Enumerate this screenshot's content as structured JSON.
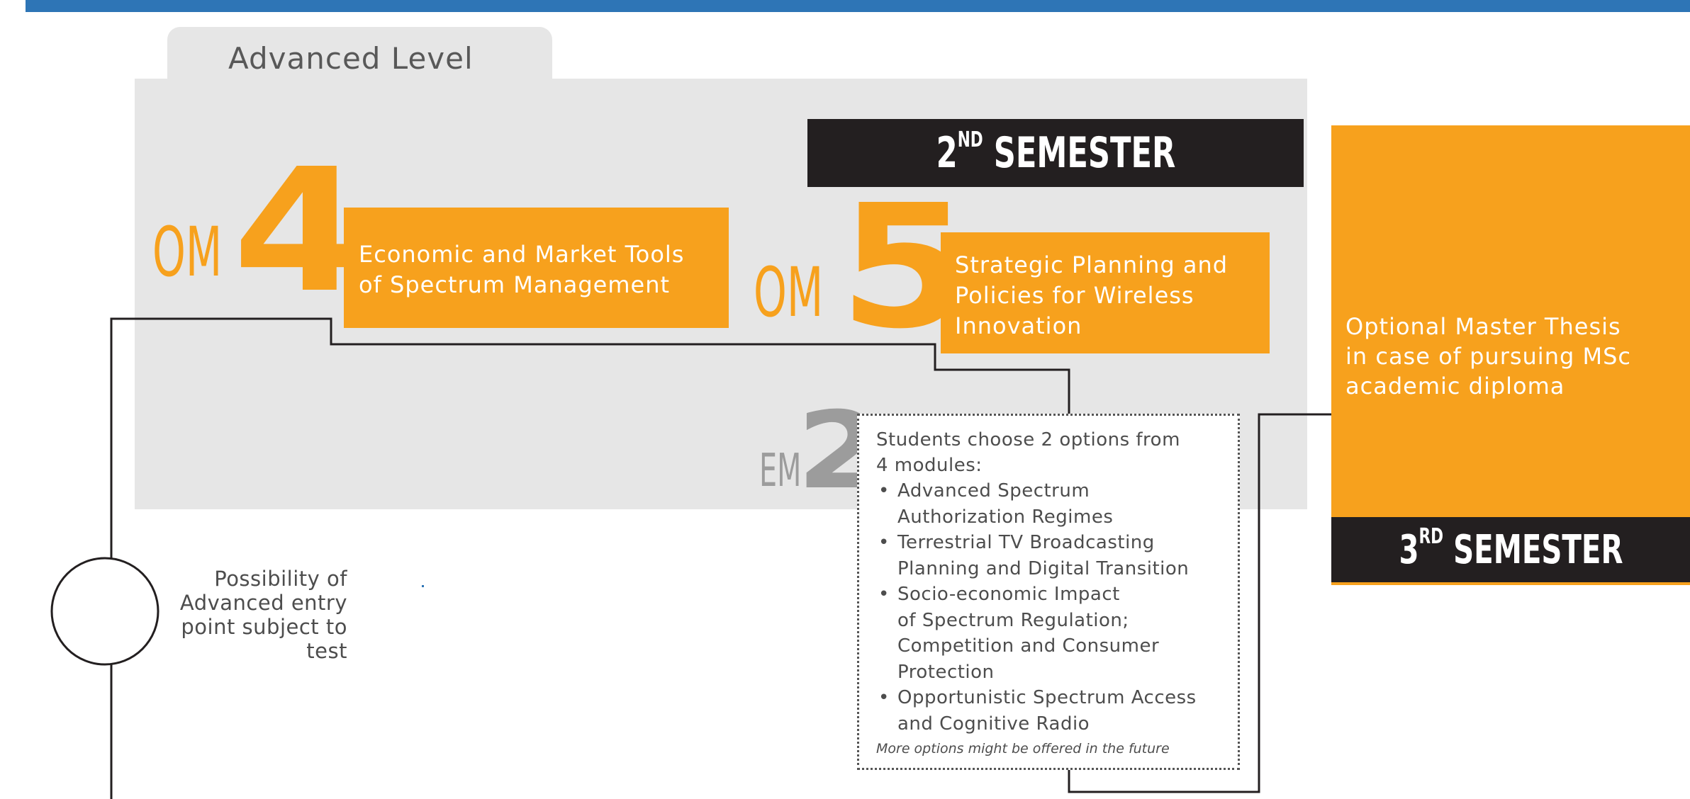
{
  "level_tab": {
    "label": "Advanced Level"
  },
  "semesters": {
    "second": {
      "number": "2",
      "suffix": "ND",
      "word": "SEMESTER"
    },
    "third": {
      "number": "3",
      "suffix": "RD",
      "word": "SEMESTER"
    }
  },
  "modules": {
    "om4": {
      "prefix": "OM",
      "number": "4",
      "lines": [
        "Economic and Market Tools",
        "of Spectrum Management"
      ]
    },
    "om5": {
      "prefix": "OM",
      "number": "5",
      "lines": [
        "Strategic Planning and",
        "Policies for Wireless",
        "Innovation"
      ]
    }
  },
  "elective": {
    "prefix": "EM",
    "number": "2",
    "intro": [
      "Students choose 2 options from",
      "4 modules:"
    ],
    "options": [
      [
        "Advanced Spectrum",
        "Authorization Regimes"
      ],
      [
        "Terrestrial TV Broadcasting",
        "Planning and Digital Transition"
      ],
      [
        "Socio-economic Impact",
        "of Spectrum Regulation;",
        "Competition and Consumer",
        "Protection"
      ],
      [
        "Opportunistic Spectrum Access",
        "and Cognitive Radio"
      ]
    ],
    "bullet": "•",
    "note": "More options might be offered in the future"
  },
  "thesis": {
    "lines": [
      "Optional Master Thesis",
      "in case of pursuing MSc",
      "academic diploma"
    ]
  },
  "entry_point": {
    "lines": [
      "Possibility of",
      "Advanced entry",
      "point subject to",
      "test"
    ]
  },
  "colors": {
    "orange": "#f7a11d",
    "dark": "#231f20",
    "panel_gray": "#e6e6e6",
    "top_bar_blue": "#2e75b6",
    "em_gray": "#9c9c9c"
  }
}
